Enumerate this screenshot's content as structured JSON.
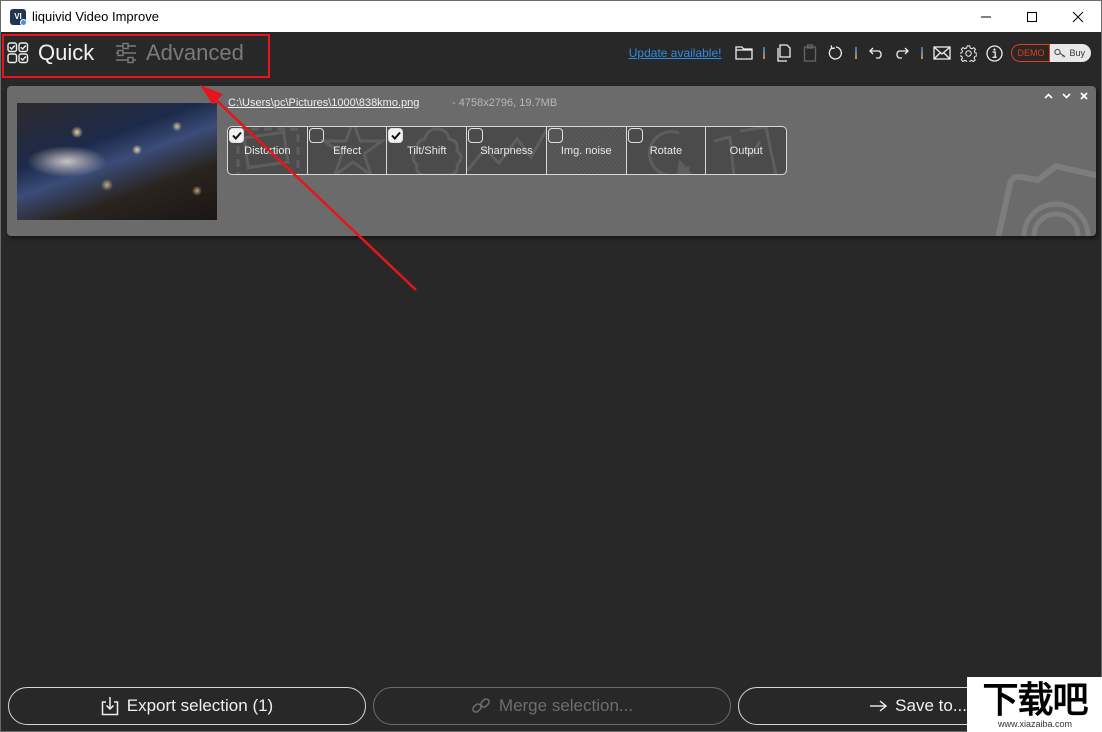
{
  "window": {
    "title": "liquivid Video Improve",
    "app_icon_text": "VI",
    "controls": {
      "minimize": "minimize",
      "maximize": "maximize",
      "close": "close"
    }
  },
  "modes": {
    "quick": {
      "label": "Quick",
      "active": true
    },
    "advanced": {
      "label": "Advanced",
      "active": false
    }
  },
  "toolbar": {
    "update_link": "Update available!",
    "icons": [
      "folder-icon",
      "copy-icon",
      "paste-icon",
      "reset-icon",
      "undo-icon",
      "redo-icon",
      "mail-icon",
      "gear-icon",
      "info-icon"
    ],
    "demo_label": "DEMO",
    "buy_label": "Buy"
  },
  "item": {
    "path": "C:\\Users\\pc\\Pictures\\1000\\838kmo.png",
    "meta": "-   4758x2796, 19.7MB",
    "tiles": [
      {
        "label": "Distortion",
        "checked": true,
        "icon": "frame-icon"
      },
      {
        "label": "Effect",
        "checked": false,
        "icon": "star-icon"
      },
      {
        "label": "Tilt/Shift",
        "checked": true,
        "icon": "tree-icon"
      },
      {
        "label": "Sharpness",
        "checked": false,
        "icon": "zigzag-icon"
      },
      {
        "label": "Img. noise",
        "checked": false,
        "icon": "noise-texture"
      },
      {
        "label": "Rotate",
        "checked": false,
        "icon": "rotate-icon"
      },
      {
        "label": "Output",
        "checked": null,
        "icon": "output-icon"
      }
    ]
  },
  "bottom": {
    "export_label": "Export selection (1)",
    "merge_label": "Merge selection...",
    "save_label": "Save to...",
    "merge_disabled": true
  },
  "watermark": {
    "big": "下载吧",
    "small": "www.xiazaiba.com"
  },
  "colors": {
    "annotation": "#e8141c",
    "link": "#2f8ce0",
    "demo": "#e43d1b",
    "background": "#282828",
    "card": "#6b6b6b"
  }
}
